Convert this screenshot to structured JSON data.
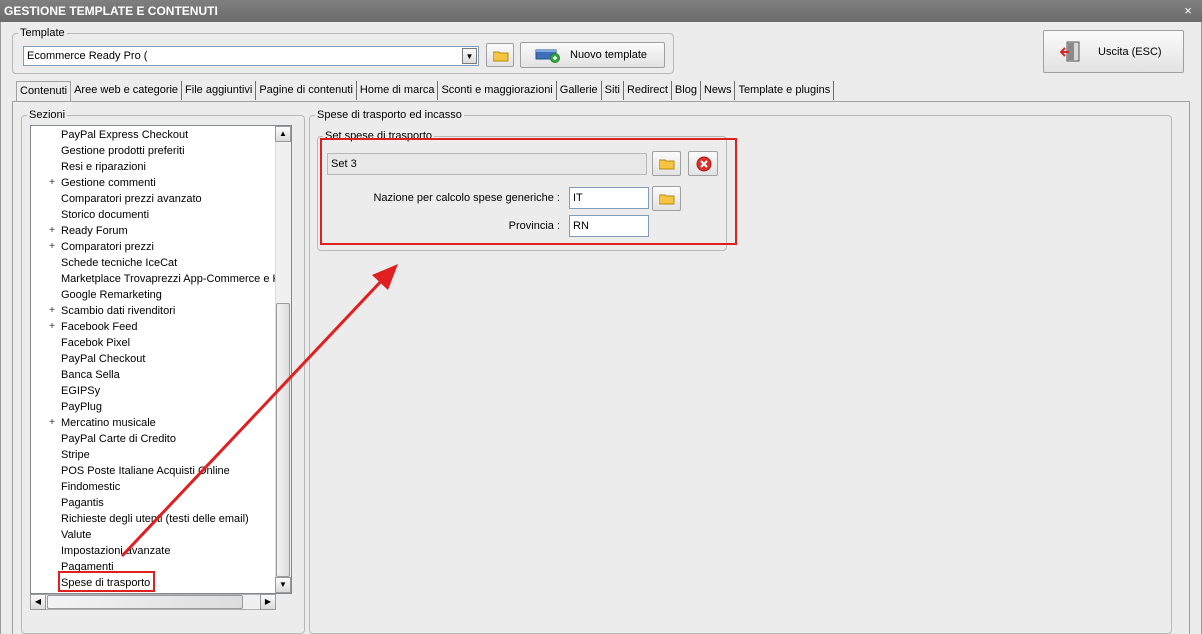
{
  "window": {
    "title": "GESTIONE TEMPLATE E CONTENUTI",
    "close_glyph": "×"
  },
  "template_group": {
    "label": "Template",
    "combo_value": "Ecommerce Ready Pro (",
    "new_template_label": "Nuovo template"
  },
  "exit_button": {
    "label": "Uscita (ESC)"
  },
  "tabs": [
    {
      "label": "Contenuti",
      "active": true
    },
    {
      "label": "Aree web e categorie"
    },
    {
      "label": "File aggiuntivi"
    },
    {
      "label": "Pagine di contenuti"
    },
    {
      "label": "Home di marca"
    },
    {
      "label": "Sconti e maggiorazioni"
    },
    {
      "label": "Gallerie"
    },
    {
      "label": "Siti"
    },
    {
      "label": "Redirect"
    },
    {
      "label": "Blog"
    },
    {
      "label": "News"
    },
    {
      "label": "Template e plugins"
    }
  ],
  "sections": {
    "label": "Sezioni",
    "items": [
      {
        "label": "PayPal Express Checkout"
      },
      {
        "label": "Gestione prodotti preferiti"
      },
      {
        "label": "Resi e riparazioni"
      },
      {
        "label": "Gestione commenti",
        "expand": "+"
      },
      {
        "label": "Comparatori prezzi avanzato"
      },
      {
        "label": "Storico documenti"
      },
      {
        "label": "Ready Forum",
        "expand": "+"
      },
      {
        "label": "Comparatori prezzi",
        "expand": "+"
      },
      {
        "label": "Schede tecniche IceCat"
      },
      {
        "label": "Marketplace Trovaprezzi App-Commerce e Ki"
      },
      {
        "label": "Google Remarketing"
      },
      {
        "label": "Scambio dati rivenditori",
        "expand": "+"
      },
      {
        "label": "Facebook Feed",
        "expand": "+"
      },
      {
        "label": "Facebok Pixel"
      },
      {
        "label": "PayPal Checkout"
      },
      {
        "label": "Banca Sella"
      },
      {
        "label": "EGIPSy"
      },
      {
        "label": "PayPlug"
      },
      {
        "label": "Mercatino musicale",
        "expand": "+"
      },
      {
        "label": "PayPal Carte di Credito"
      },
      {
        "label": "Stripe"
      },
      {
        "label": "POS Poste Italiane Acquisti Online"
      },
      {
        "label": "Findomestic"
      },
      {
        "label": "Pagantis"
      },
      {
        "label": "Richieste degli utenti (testi delle email)"
      },
      {
        "label": "Valute"
      },
      {
        "label": "Impostazioni avanzate"
      },
      {
        "label": "Pagamenti"
      },
      {
        "label": "Spese di trasporto",
        "selected": true
      }
    ]
  },
  "shipping": {
    "group_label": "Spese di trasporto ed incasso",
    "set_group_label": "Set spese di trasporto",
    "set_value": "Set 3",
    "nation_label": "Nazione per calcolo spese generiche :",
    "nation_value": "IT",
    "province_label": "Provincia :",
    "province_value": "RN"
  },
  "colors": {
    "annotation": "#e02020",
    "titlebar": "#767676",
    "window_bg": "#ececec"
  }
}
